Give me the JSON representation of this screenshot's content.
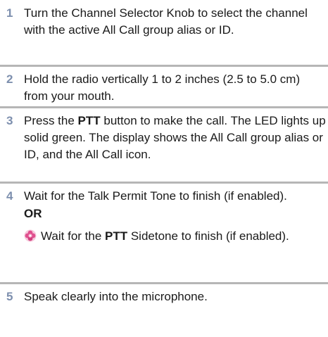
{
  "steps": [
    {
      "number": "1",
      "text": "Turn the Channel Selector Knob to select the channel with the active All Call group alias or ID."
    },
    {
      "number": "2",
      "text": "Hold the radio vertically 1 to 2 inches (2.5 to 5.0 cm) from your mouth."
    },
    {
      "number": "3",
      "pre": "Press the ",
      "bold": "PTT",
      "post": " button to make the call. The LED lights up solid green. The display shows the All Call group alias or ID, and the All Call icon."
    },
    {
      "number": "4",
      "text": "Wait for the Talk Permit Tone to finish (if enabled).",
      "or_label": "OR",
      "alt_pre": "Wait for the ",
      "alt_bold": "PTT",
      "alt_post": " Sidetone to finish (if enabled).",
      "alt_icon": "flower-icon"
    },
    {
      "number": "5",
      "text": "Speak clearly into the microphone."
    }
  ],
  "colors": {
    "step_number": "#7d8fae",
    "divider": "#b6b6b6",
    "icon_petal": "#e0508f"
  }
}
